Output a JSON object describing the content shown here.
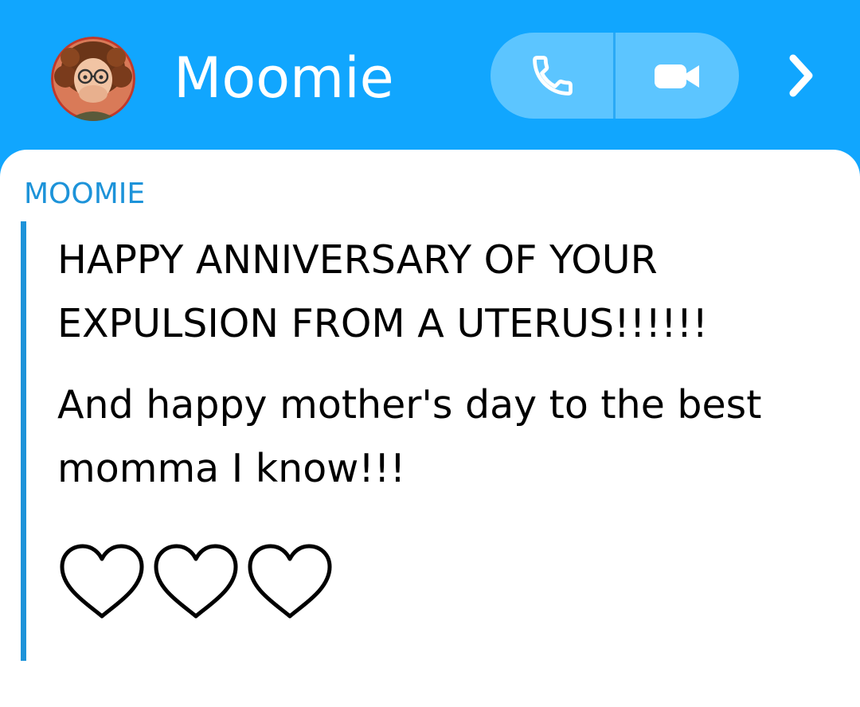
{
  "header": {
    "title": "Moomie",
    "background_color": "#11a6fe",
    "avatar_icon": "bitmoji-avatar",
    "voice_call_icon": "phone-icon",
    "video_call_icon": "video-camera-icon",
    "more_icon": "chevron-right-icon"
  },
  "chat": {
    "sender": "MOOMIE",
    "sender_color": "#1d93d9",
    "messages": [
      "HAPPY ANNIVERSARY OF YOUR EXPULSION FROM A UTERUS!!!!!!",
      "And happy mother's day to the best momma I know!!!",
      "♡♡♡"
    ]
  }
}
